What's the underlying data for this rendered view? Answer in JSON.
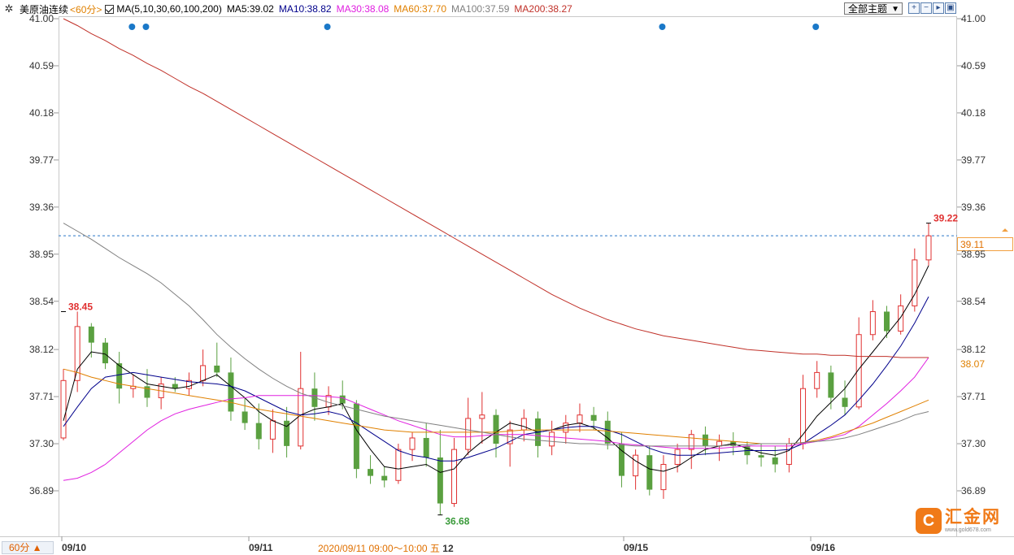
{
  "toolbar": {
    "symbol": "美原油连续",
    "period": "<60分>",
    "ma_params": "MA(5,10,30,60,100,200)",
    "ma5": "MA5:39.02",
    "ma10": "MA10:38.82",
    "ma30": "MA30:38.08",
    "ma60": "MA60:37.70",
    "ma100": "MA100:37.59",
    "ma200": "MA200:38.27",
    "theme_label": "全部主题",
    "settings_icon": "gear-icon",
    "tool_buttons": [
      "zoom-in-icon",
      "zoom-out-icon",
      "scroll-right-icon",
      "fullscreen-icon"
    ]
  },
  "colors": {
    "up": "#e03030",
    "down": "#5aa040",
    "ma5": "#000000",
    "ma10": "#00008b",
    "ma30": "#e020e0",
    "ma60": "#e08000",
    "ma100": "#808080",
    "ma200": "#c03028",
    "dashed": "#2a78c8",
    "marker": "#1a78c8"
  },
  "bottom": {
    "period_button": "60分 ▲",
    "crosshair_time": "2020/09/11 09:00～10:00",
    "crosshair_weekday": "五",
    "crosshair_day": "12"
  },
  "price_tag": "39.11",
  "ma60_tag": "38.07",
  "logo": {
    "name": "汇金网",
    "url": "www.gold678.com",
    "mark": "C"
  },
  "chart_data": {
    "type": "candlestick",
    "x_labels": [
      "09/10",
      "09/11",
      "09/15",
      "09/16"
    ],
    "y_ticks": [
      "41.00",
      "40.59",
      "40.18",
      "39.77",
      "39.36",
      "38.95",
      "38.54",
      "38.12",
      "37.71",
      "37.30",
      "36.89"
    ],
    "ylim": [
      36.76,
      41.0
    ],
    "last_price": 39.11,
    "annotations": [
      {
        "label": "38.45",
        "value": 38.45,
        "index": 0,
        "color": "#e03030"
      },
      {
        "label": "36.68",
        "value": 36.68,
        "index": 27,
        "color": "#3a9a3a"
      },
      {
        "label": "39.22",
        "value": 39.22,
        "index": 62,
        "color": "#e03030"
      }
    ],
    "candles": [
      {
        "o": 37.35,
        "h": 37.95,
        "l": 37.33,
        "c": 37.85
      },
      {
        "o": 37.85,
        "h": 38.45,
        "l": 37.75,
        "c": 38.32
      },
      {
        "o": 38.32,
        "h": 38.35,
        "l": 38.05,
        "c": 38.18
      },
      {
        "o": 38.18,
        "h": 38.22,
        "l": 37.95,
        "c": 38.0
      },
      {
        "o": 38.0,
        "h": 38.1,
        "l": 37.65,
        "c": 37.78
      },
      {
        "o": 37.78,
        "h": 37.9,
        "l": 37.7,
        "c": 37.8
      },
      {
        "o": 37.8,
        "h": 37.95,
        "l": 37.62,
        "c": 37.7
      },
      {
        "o": 37.7,
        "h": 37.88,
        "l": 37.6,
        "c": 37.82
      },
      {
        "o": 37.82,
        "h": 37.88,
        "l": 37.75,
        "c": 37.78
      },
      {
        "o": 37.78,
        "h": 37.92,
        "l": 37.72,
        "c": 37.85
      },
      {
        "o": 37.85,
        "h": 38.12,
        "l": 37.8,
        "c": 37.98
      },
      {
        "o": 37.98,
        "h": 38.18,
        "l": 37.88,
        "c": 37.92
      },
      {
        "o": 37.92,
        "h": 38.05,
        "l": 37.5,
        "c": 37.58
      },
      {
        "o": 37.58,
        "h": 37.7,
        "l": 37.42,
        "c": 37.48
      },
      {
        "o": 37.48,
        "h": 37.65,
        "l": 37.25,
        "c": 37.34
      },
      {
        "o": 37.34,
        "h": 37.6,
        "l": 37.22,
        "c": 37.5
      },
      {
        "o": 37.5,
        "h": 37.62,
        "l": 37.18,
        "c": 37.28
      },
      {
        "o": 37.28,
        "h": 38.1,
        "l": 37.25,
        "c": 37.78
      },
      {
        "o": 37.78,
        "h": 37.92,
        "l": 37.5,
        "c": 37.62
      },
      {
        "o": 37.62,
        "h": 37.8,
        "l": 37.55,
        "c": 37.72
      },
      {
        "o": 37.72,
        "h": 37.85,
        "l": 37.6,
        "c": 37.65
      },
      {
        "o": 37.65,
        "h": 37.68,
        "l": 37.0,
        "c": 37.08
      },
      {
        "o": 37.08,
        "h": 37.2,
        "l": 36.95,
        "c": 37.02
      },
      {
        "o": 37.02,
        "h": 37.1,
        "l": 36.92,
        "c": 36.98
      },
      {
        "o": 36.98,
        "h": 37.3,
        "l": 36.95,
        "c": 37.25
      },
      {
        "o": 37.25,
        "h": 37.4,
        "l": 37.15,
        "c": 37.35
      },
      {
        "o": 37.35,
        "h": 37.48,
        "l": 37.1,
        "c": 37.18
      },
      {
        "o": 37.18,
        "h": 37.42,
        "l": 36.68,
        "c": 36.78
      },
      {
        "o": 36.78,
        "h": 37.35,
        "l": 36.75,
        "c": 37.25
      },
      {
        "o": 37.25,
        "h": 37.7,
        "l": 37.2,
        "c": 37.52
      },
      {
        "o": 37.52,
        "h": 37.75,
        "l": 37.3,
        "c": 37.55
      },
      {
        "o": 37.55,
        "h": 37.6,
        "l": 37.18,
        "c": 37.3
      },
      {
        "o": 37.3,
        "h": 37.5,
        "l": 37.1,
        "c": 37.42
      },
      {
        "o": 37.42,
        "h": 37.6,
        "l": 37.32,
        "c": 37.52
      },
      {
        "o": 37.52,
        "h": 37.58,
        "l": 37.18,
        "c": 37.28
      },
      {
        "o": 37.28,
        "h": 37.5,
        "l": 37.2,
        "c": 37.4
      },
      {
        "o": 37.4,
        "h": 37.55,
        "l": 37.3,
        "c": 37.48
      },
      {
        "o": 37.48,
        "h": 37.65,
        "l": 37.4,
        "c": 37.55
      },
      {
        "o": 37.55,
        "h": 37.62,
        "l": 37.42,
        "c": 37.5
      },
      {
        "o": 37.5,
        "h": 37.58,
        "l": 37.25,
        "c": 37.3
      },
      {
        "o": 37.3,
        "h": 37.4,
        "l": 36.92,
        "c": 37.02
      },
      {
        "o": 37.02,
        "h": 37.25,
        "l": 36.9,
        "c": 37.2
      },
      {
        "o": 37.2,
        "h": 37.28,
        "l": 36.85,
        "c": 36.9
      },
      {
        "o": 36.9,
        "h": 37.2,
        "l": 36.82,
        "c": 37.12
      },
      {
        "o": 37.12,
        "h": 37.3,
        "l": 37.05,
        "c": 37.25
      },
      {
        "o": 37.25,
        "h": 37.42,
        "l": 37.08,
        "c": 37.38
      },
      {
        "o": 37.38,
        "h": 37.45,
        "l": 37.2,
        "c": 37.28
      },
      {
        "o": 37.28,
        "h": 37.38,
        "l": 37.15,
        "c": 37.32
      },
      {
        "o": 37.32,
        "h": 37.4,
        "l": 37.2,
        "c": 37.28
      },
      {
        "o": 37.28,
        "h": 37.32,
        "l": 37.12,
        "c": 37.2
      },
      {
        "o": 37.2,
        "h": 37.3,
        "l": 37.1,
        "c": 37.18
      },
      {
        "o": 37.18,
        "h": 37.28,
        "l": 37.05,
        "c": 37.12
      },
      {
        "o": 37.12,
        "h": 37.35,
        "l": 37.05,
        "c": 37.3
      },
      {
        "o": 37.3,
        "h": 37.9,
        "l": 37.25,
        "c": 37.78
      },
      {
        "o": 37.78,
        "h": 38.02,
        "l": 37.7,
        "c": 37.92
      },
      {
        "o": 37.92,
        "h": 37.98,
        "l": 37.6,
        "c": 37.7
      },
      {
        "o": 37.7,
        "h": 37.85,
        "l": 37.55,
        "c": 37.62
      },
      {
        "o": 37.62,
        "h": 38.4,
        "l": 37.6,
        "c": 38.25
      },
      {
        "o": 38.25,
        "h": 38.55,
        "l": 38.2,
        "c": 38.45
      },
      {
        "o": 38.45,
        "h": 38.5,
        "l": 38.22,
        "c": 38.28
      },
      {
        "o": 38.28,
        "h": 38.6,
        "l": 38.25,
        "c": 38.5
      },
      {
        "o": 38.5,
        "h": 39.0,
        "l": 38.45,
        "c": 38.9
      },
      {
        "o": 38.9,
        "h": 39.22,
        "l": 38.85,
        "c": 39.11
      }
    ],
    "series": [
      {
        "name": "MA5",
        "values": [
          37.5,
          37.95,
          38.1,
          38.08,
          37.98,
          37.9,
          37.82,
          37.8,
          37.78,
          37.8,
          37.85,
          37.9,
          37.8,
          37.7,
          37.58,
          37.5,
          37.45,
          37.55,
          37.6,
          37.62,
          37.65,
          37.42,
          37.25,
          37.1,
          37.08,
          37.1,
          37.12,
          37.05,
          37.08,
          37.22,
          37.32,
          37.4,
          37.48,
          37.45,
          37.4,
          37.42,
          37.46,
          37.48,
          37.44,
          37.35,
          37.24,
          37.15,
          37.08,
          37.06,
          37.1,
          37.18,
          37.25,
          37.28,
          37.3,
          37.26,
          37.22,
          37.2,
          37.24,
          37.38,
          37.54,
          37.66,
          37.78,
          37.95,
          38.1,
          38.25,
          38.4,
          38.6,
          38.85
        ]
      },
      {
        "name": "MA10",
        "values": [
          37.45,
          37.62,
          37.78,
          37.88,
          37.9,
          37.92,
          37.9,
          37.88,
          37.86,
          37.84,
          37.83,
          37.82,
          37.8,
          37.76,
          37.7,
          37.64,
          37.58,
          37.55,
          37.56,
          37.58,
          37.55,
          37.48,
          37.4,
          37.32,
          37.24,
          37.2,
          37.18,
          37.15,
          37.15,
          37.18,
          37.22,
          37.26,
          37.32,
          37.38,
          37.4,
          37.42,
          37.44,
          37.45,
          37.45,
          37.42,
          37.38,
          37.32,
          37.26,
          37.22,
          37.2,
          37.2,
          37.21,
          37.22,
          37.23,
          37.24,
          37.24,
          37.24,
          37.25,
          37.3,
          37.38,
          37.46,
          37.55,
          37.68,
          37.82,
          37.98,
          38.15,
          38.35,
          38.58
        ]
      },
      {
        "name": "MA30",
        "values": [
          36.98,
          37.0,
          37.05,
          37.12,
          37.22,
          37.32,
          37.42,
          37.5,
          37.56,
          37.6,
          37.63,
          37.66,
          37.69,
          37.7,
          37.72,
          37.72,
          37.72,
          37.72,
          37.72,
          37.71,
          37.7,
          37.65,
          37.6,
          37.55,
          37.5,
          37.46,
          37.42,
          37.38,
          37.36,
          37.36,
          37.37,
          37.38,
          37.38,
          37.38,
          37.37,
          37.36,
          37.35,
          37.34,
          37.33,
          37.32,
          37.3,
          37.29,
          37.28,
          37.27,
          37.26,
          37.26,
          37.26,
          37.26,
          37.27,
          37.28,
          37.28,
          37.28,
          37.28,
          37.3,
          37.32,
          37.35,
          37.38,
          37.45,
          37.55,
          37.65,
          37.76,
          37.88,
          38.05
        ]
      },
      {
        "name": "MA60",
        "values": [
          37.95,
          37.92,
          37.88,
          37.85,
          37.82,
          37.8,
          37.78,
          37.76,
          37.74,
          37.72,
          37.7,
          37.68,
          37.66,
          37.63,
          37.6,
          37.58,
          37.56,
          37.54,
          37.52,
          37.5,
          37.48,
          37.46,
          37.44,
          37.42,
          37.41,
          37.4,
          37.4,
          37.4,
          37.4,
          37.4,
          37.4,
          37.4,
          37.41,
          37.42,
          37.42,
          37.42,
          37.42,
          37.42,
          37.42,
          37.41,
          37.4,
          37.39,
          37.38,
          37.37,
          37.36,
          37.35,
          37.34,
          37.33,
          37.32,
          37.31,
          37.3,
          37.3,
          37.3,
          37.31,
          37.33,
          37.36,
          37.4,
          37.44,
          37.48,
          37.53,
          37.58,
          37.63,
          37.68
        ]
      },
      {
        "name": "MA100",
        "values": [
          39.22,
          39.15,
          39.08,
          39.0,
          38.92,
          38.85,
          38.78,
          38.7,
          38.6,
          38.5,
          38.38,
          38.25,
          38.14,
          38.04,
          37.95,
          37.87,
          37.8,
          37.74,
          37.7,
          37.66,
          37.63,
          37.6,
          37.57,
          37.54,
          37.52,
          37.5,
          37.48,
          37.46,
          37.44,
          37.42,
          37.4,
          37.38,
          37.36,
          37.34,
          37.33,
          37.32,
          37.31,
          37.3,
          37.3,
          37.29,
          37.29,
          37.28,
          37.28,
          37.28,
          37.28,
          37.28,
          37.28,
          37.28,
          37.29,
          37.29,
          37.3,
          37.3,
          37.3,
          37.31,
          37.32,
          37.33,
          37.35,
          37.38,
          37.42,
          37.46,
          37.5,
          37.55,
          37.58
        ]
      },
      {
        "name": "MA200",
        "values": [
          41.0,
          40.94,
          40.87,
          40.81,
          40.74,
          40.68,
          40.61,
          40.55,
          40.48,
          40.41,
          40.35,
          40.28,
          40.21,
          40.14,
          40.07,
          40.0,
          39.93,
          39.86,
          39.79,
          39.72,
          39.65,
          39.58,
          39.51,
          39.44,
          39.37,
          39.3,
          39.23,
          39.16,
          39.09,
          39.02,
          38.95,
          38.88,
          38.81,
          38.74,
          38.67,
          38.6,
          38.54,
          38.48,
          38.43,
          38.38,
          38.34,
          38.3,
          38.27,
          38.24,
          38.22,
          38.2,
          38.18,
          38.16,
          38.14,
          38.12,
          38.11,
          38.1,
          38.09,
          38.08,
          38.08,
          38.07,
          38.07,
          38.06,
          38.06,
          38.06,
          38.05,
          38.05,
          38.05
        ]
      }
    ],
    "event_markers": [
      2,
      3,
      16,
      40,
      51
    ]
  }
}
